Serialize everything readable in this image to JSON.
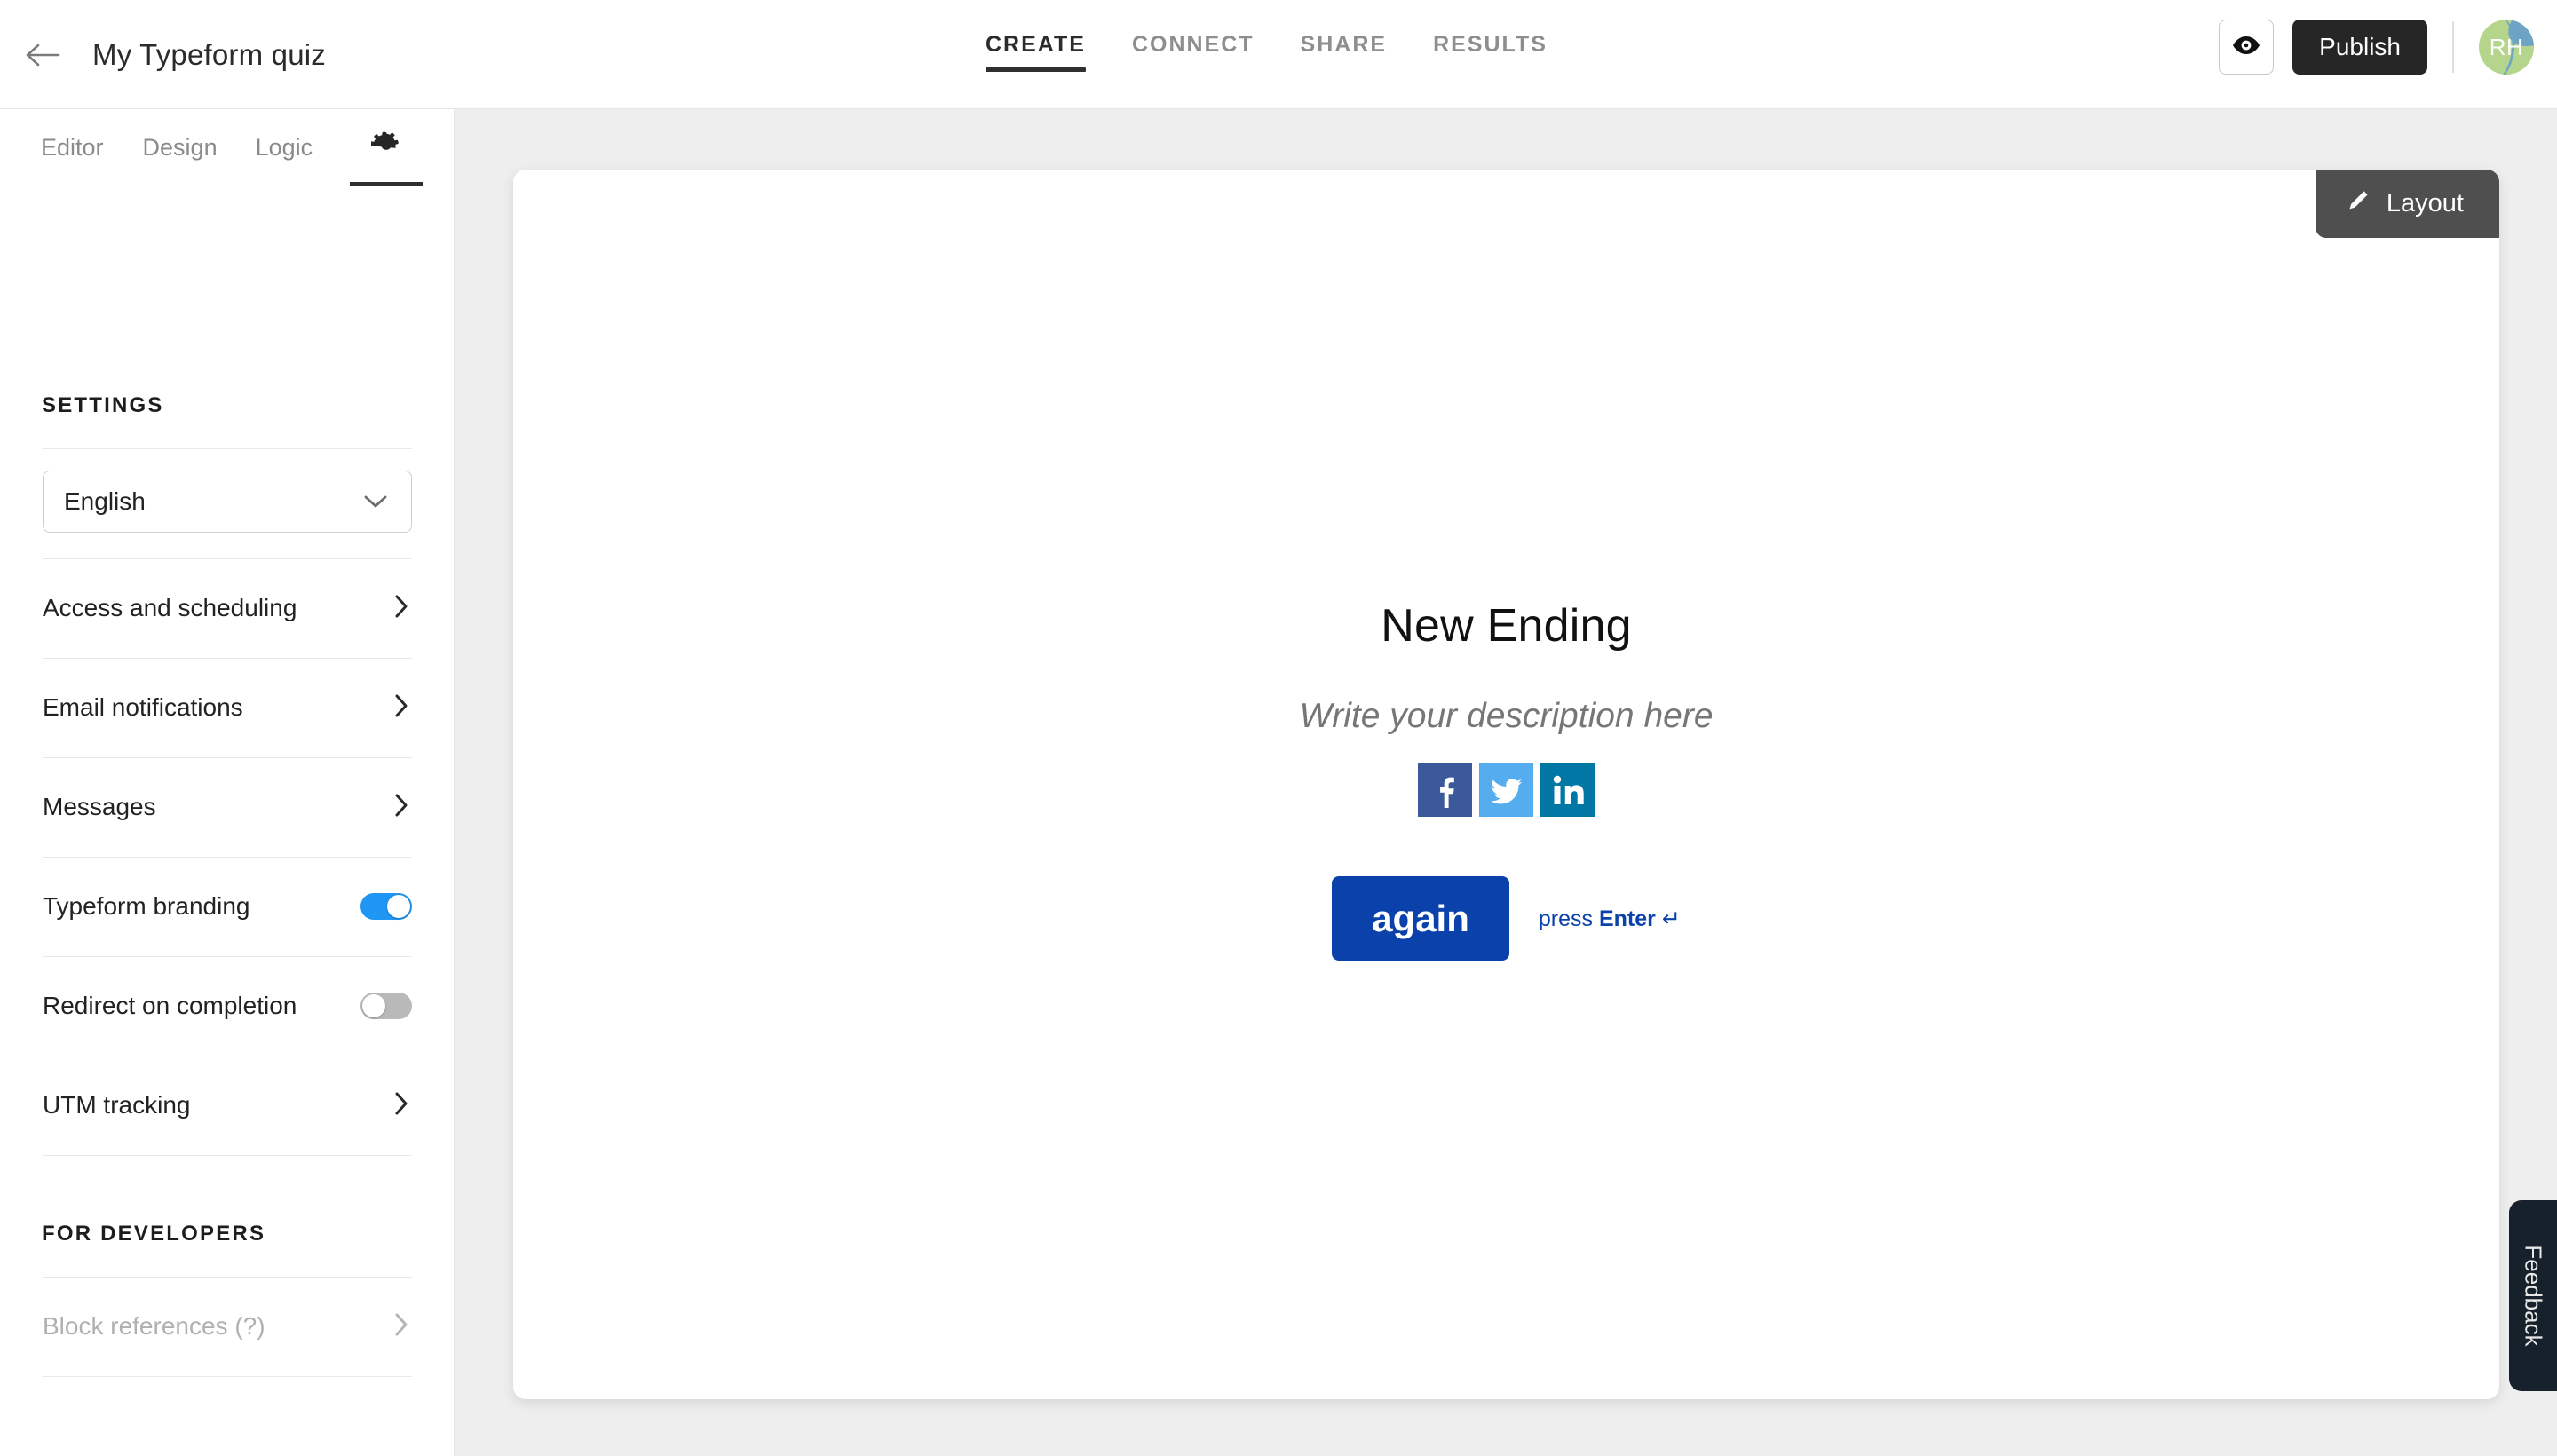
{
  "header": {
    "back_icon": "arrow-left-icon",
    "form_title": "My Typeform quiz",
    "tabs": [
      {
        "label": "CREATE",
        "active": true
      },
      {
        "label": "CONNECT",
        "active": false
      },
      {
        "label": "SHARE",
        "active": false
      },
      {
        "label": "RESULTS",
        "active": false
      }
    ],
    "preview_icon": "eye-icon",
    "publish_label": "Publish",
    "avatar_initials": "RH",
    "avatar_bg": "#b6d58c",
    "avatar_accent": "#6da3c4"
  },
  "sidebar": {
    "tabs": [
      {
        "label": "Editor",
        "active": false
      },
      {
        "label": "Design",
        "active": false
      },
      {
        "label": "Logic",
        "active": false
      },
      {
        "label": "gear-icon",
        "active": true
      }
    ],
    "settings_heading": "SETTINGS",
    "language": {
      "value": "English",
      "chevron": "chevron-down-icon"
    },
    "items": [
      {
        "label": "Access and scheduling",
        "type": "link",
        "disabled": false
      },
      {
        "label": "Email notifications",
        "type": "link",
        "disabled": false
      },
      {
        "label": "Messages",
        "type": "link",
        "disabled": false
      },
      {
        "label": "Typeform branding",
        "type": "toggle",
        "on": true
      },
      {
        "label": "Redirect on completion",
        "type": "toggle",
        "on": false
      },
      {
        "label": "UTM tracking",
        "type": "link",
        "disabled": false
      }
    ],
    "developers_heading": "FOR DEVELOPERS",
    "developer_items": [
      {
        "label": "Block references (?)",
        "type": "link",
        "disabled": true
      }
    ],
    "toggle_on_color": "#1f96f3",
    "toggle_off_color": "#b9b9b9"
  },
  "canvas": {
    "layout_badge": {
      "icon": "pencil-icon",
      "label": "Layout",
      "bg": "#4f4f4f"
    },
    "ending": {
      "title": "New Ending",
      "description": "Write your description here",
      "socials": [
        {
          "name": "facebook-icon",
          "color": "#3b5998"
        },
        {
          "name": "twitter-icon",
          "color": "#55acee"
        },
        {
          "name": "linkedin-icon",
          "color": "#0077a5"
        }
      ],
      "button_label": "again",
      "button_color": "#0b41ab",
      "hint_prefix": "press ",
      "hint_key": "Enter",
      "hint_suffix": " ↵"
    }
  },
  "feedback": {
    "label": "Feedback",
    "bg": "#16212b"
  }
}
